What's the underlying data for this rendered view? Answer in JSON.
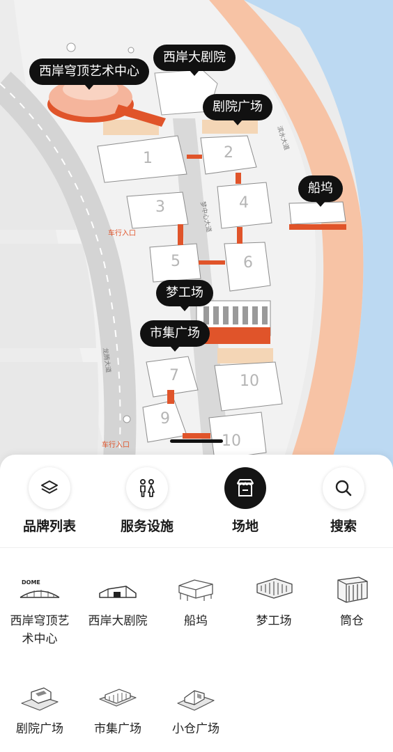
{
  "map": {
    "road_labels": {
      "road_center": "梦中心大道",
      "road_riverside": "滨水大道",
      "road_longteng": "龙腾大道",
      "entrance_1": "车行入口",
      "entrance_2": "车行入口"
    },
    "building_numbers": [
      "1",
      "2",
      "3",
      "4",
      "5",
      "6",
      "7",
      "9",
      "10",
      "10"
    ],
    "callouts": {
      "dome": "西岸穹顶艺术中心",
      "grand_theatre": "西岸大剧院",
      "theatre_plaza": "剧院广场",
      "dock": "船坞",
      "dream_factory": "梦工场",
      "market_plaza": "市集广场"
    }
  },
  "tabs": [
    {
      "label": "品牌列表",
      "icon": "layers-icon",
      "active": false
    },
    {
      "label": "服务设施",
      "icon": "restroom-icon",
      "active": false
    },
    {
      "label": "场地",
      "icon": "venue-store-icon",
      "active": true
    },
    {
      "label": "搜索",
      "icon": "search-icon",
      "active": false
    }
  ],
  "venues": [
    {
      "line1": "西岸穹顶艺",
      "line2": "术中心",
      "icon": "dome-building-icon",
      "logo_text": "DOME"
    },
    {
      "line1": "西岸大剧院",
      "line2": "",
      "icon": "theatre-building-icon"
    },
    {
      "line1": "船坞",
      "line2": "",
      "icon": "dock-building-icon"
    },
    {
      "line1": "梦工场",
      "line2": "",
      "icon": "dream-factory-icon"
    },
    {
      "line1": "筒仓",
      "line2": "",
      "icon": "silo-icon"
    },
    {
      "line1": "剧院广场",
      "line2": "",
      "icon": "theatre-plaza-icon"
    },
    {
      "line1": "市集广场",
      "line2": "",
      "icon": "market-plaza-icon"
    },
    {
      "line1": "小仓广场",
      "line2": "",
      "icon": "small-warehouse-plaza-icon"
    }
  ],
  "colors": {
    "accent_orange": "#e0542a",
    "river": "#bcd9f2",
    "promenade": "#f7c3a5",
    "active_tab": "#141414"
  }
}
